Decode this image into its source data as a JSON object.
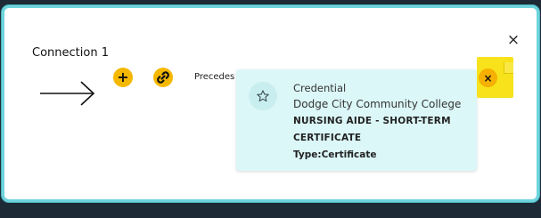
{
  "modal": {
    "close_glyph": "×",
    "connection_label": "Connection 1",
    "add_glyph": "+",
    "relation_label": "Precedes",
    "remove_glyph": "×"
  },
  "credential_card": {
    "type": "Credential",
    "organization": "Dodge City Community College",
    "name": "NURSING AIDE - SHORT-TERM CERTIFICATE",
    "credential_type": "Type:Certificate",
    "icon": "star-outline-icon"
  },
  "colors": {
    "accent_border": "#6fd3dc",
    "button_yellow": "#f5b800",
    "card_background": "#dcf7f8",
    "remove_tile_yellow": "#f7e21c"
  }
}
